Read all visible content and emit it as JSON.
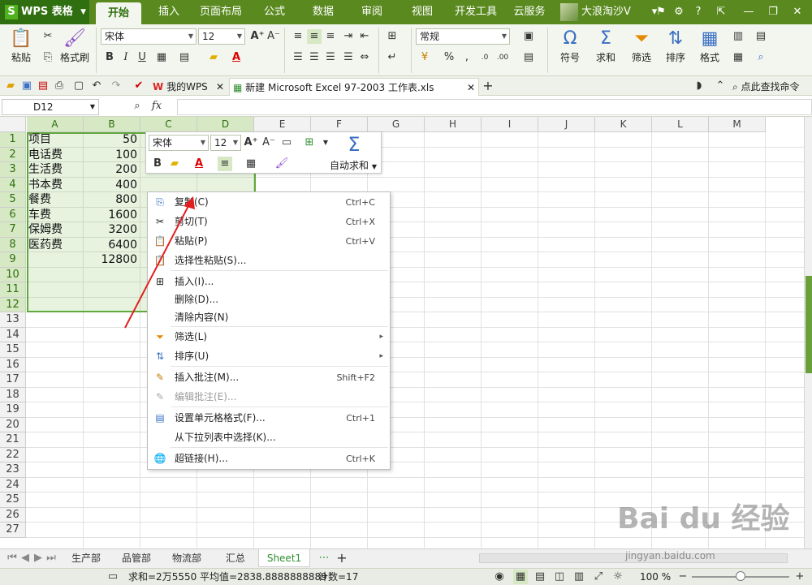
{
  "app": {
    "name": "WPS 表格",
    "logo_letter": "S"
  },
  "ribbon_tabs": [
    "开始",
    "插入",
    "页面布局",
    "公式",
    "数据",
    "审阅",
    "视图",
    "开发工具",
    "云服务"
  ],
  "active_tab": "开始",
  "user": {
    "name": "大浪淘沙V"
  },
  "ribbon": {
    "paste": "粘贴",
    "format_painter": "格式刷",
    "font_name": "宋体",
    "font_size": "12",
    "number_format": "常规",
    "symbol": "符号",
    "sum": "求和",
    "filter": "筛选",
    "sort": "排序",
    "format": "格式",
    "bold": "B",
    "italic": "I",
    "underline": "U",
    "font_color_glyph": "A",
    "percent": "%",
    "comma": ",",
    "inc_decimal": ".0",
    "dec_decimal": ".00"
  },
  "doc_tabs": [
    {
      "label": "我的WPS"
    },
    {
      "label": "新建 Microsoft Excel 97-2003 工作表.xls"
    }
  ],
  "find_command": "点此查找命令",
  "formula_bar": {
    "name_box": "D12",
    "fx": "fx",
    "content": ""
  },
  "columns": [
    "A",
    "B",
    "C",
    "D",
    "E",
    "F",
    "G",
    "H",
    "I",
    "J",
    "K",
    "L",
    "M"
  ],
  "rows": [
    "1",
    "2",
    "3",
    "4",
    "5",
    "6",
    "7",
    "8",
    "9",
    "10",
    "11",
    "12",
    "13",
    "14",
    "15",
    "16",
    "17",
    "18",
    "19",
    "20",
    "21",
    "22",
    "23",
    "24",
    "25",
    "26",
    "27"
  ],
  "cells": {
    "A": [
      "项目",
      "电话费",
      "生活费",
      "书本费",
      "餐费",
      "车费",
      "保姆费",
      "医药费",
      "",
      "",
      "",
      ""
    ],
    "B": [
      "50",
      "100",
      "200",
      "400",
      "800",
      "1600",
      "3200",
      "6400",
      "12800",
      "",
      "",
      ""
    ]
  },
  "mini_toolbar": {
    "font_name": "宋体",
    "font_size": "12",
    "bold": "B",
    "font_color_glyph": "A",
    "autosum_label": "自动求和"
  },
  "context_menu": [
    {
      "label": "复制(C)",
      "shortcut": "Ctrl+C",
      "icon": "copy-icon"
    },
    {
      "label": "剪切(T)",
      "shortcut": "Ctrl+X",
      "icon": "scissors-icon"
    },
    {
      "label": "粘贴(P)",
      "shortcut": "Ctrl+V",
      "icon": "paste-icon"
    },
    {
      "label": "选择性粘贴(S)...",
      "shortcut": "",
      "icon": "paste-special-icon"
    },
    {
      "label": "插入(I)...",
      "shortcut": "",
      "icon": "insert-icon"
    },
    {
      "label": "删除(D)...",
      "shortcut": "",
      "icon": ""
    },
    {
      "label": "清除内容(N)",
      "shortcut": "",
      "icon": ""
    },
    {
      "label": "筛选(L)",
      "shortcut": "",
      "icon": "filter-icon",
      "submenu": true
    },
    {
      "label": "排序(U)",
      "shortcut": "",
      "icon": "sort-icon",
      "submenu": true
    },
    {
      "label": "插入批注(M)...",
      "shortcut": "Shift+F2",
      "icon": "comment-icon"
    },
    {
      "label": "编辑批注(E)...",
      "shortcut": "",
      "icon": "edit-comment-icon",
      "disabled": true
    },
    {
      "label": "设置单元格格式(F)...",
      "shortcut": "Ctrl+1",
      "icon": "format-cells-icon"
    },
    {
      "label": "从下拉列表中选择(K)...",
      "shortcut": "",
      "icon": ""
    },
    {
      "label": "超链接(H)...",
      "shortcut": "Ctrl+K",
      "icon": "hyperlink-icon"
    }
  ],
  "sheet_tabs": [
    "生产部",
    "品管部",
    "物流部",
    "汇总",
    "Sheet1"
  ],
  "active_sheet": "Sheet1",
  "status": {
    "sum": "求和=2万5550",
    "average": "平均值=2838.8888888889",
    "count": "计数=17",
    "zoom": "100 %"
  },
  "watermark": {
    "text": "Bai du 经验",
    "url_text": "jingyan.baidu.com"
  },
  "colors": {
    "brand_green": "#5a8a1f",
    "selection": "#5fa83a",
    "ribbon_bg": "#f3f6ee"
  }
}
